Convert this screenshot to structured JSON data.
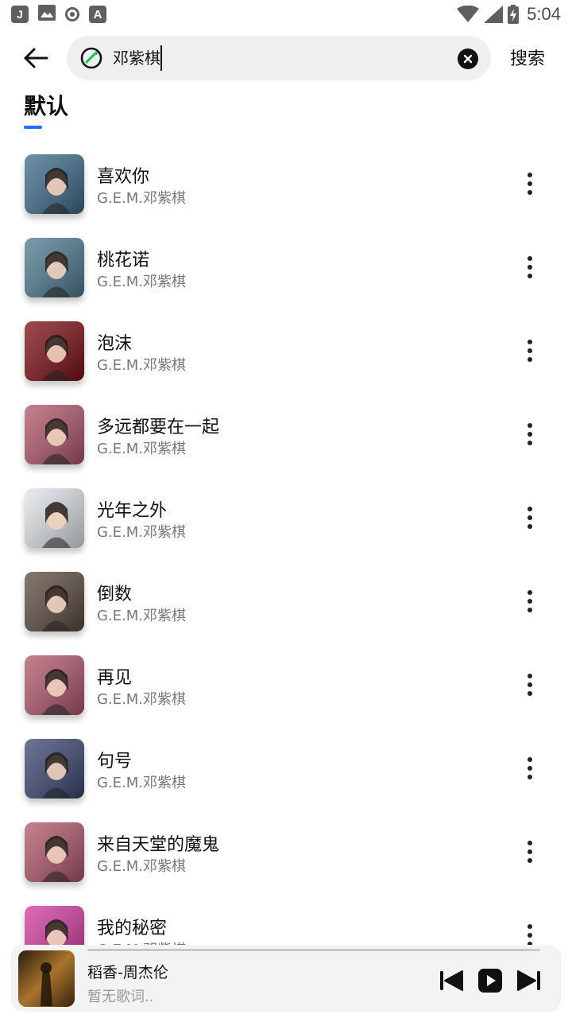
{
  "status_bar": {
    "left_icons": [
      "j-app-icon",
      "image-icon",
      "record-icon",
      "font-a-icon"
    ],
    "time": "5:04"
  },
  "search": {
    "query": "邓紫棋",
    "search_label": "搜索"
  },
  "tab": {
    "label": "默认"
  },
  "songs": [
    {
      "title": "喜欢你",
      "artist": "G.E.M.邓紫棋",
      "cover_color": "#3c6a8a"
    },
    {
      "title": "桃花诺",
      "artist": "G.E.M.邓紫棋",
      "cover_color": "#4d7a8f"
    },
    {
      "title": "泡沫",
      "artist": "G.E.M.邓紫棋",
      "cover_color": "#7a0d12"
    },
    {
      "title": "多远都要在一起",
      "artist": "G.E.M.邓紫棋",
      "cover_color": "#b0556a"
    },
    {
      "title": "光年之外",
      "artist": "G.E.M.邓紫棋",
      "cover_color": "#dfe5ea"
    },
    {
      "title": "倒数",
      "artist": "G.E.M.邓紫棋",
      "cover_color": "#5a4a3e"
    },
    {
      "title": "再见",
      "artist": "G.E.M.邓紫棋",
      "cover_color": "#b0556a"
    },
    {
      "title": "句号",
      "artist": "G.E.M.邓紫棋",
      "cover_color": "#3a4570"
    },
    {
      "title": "来自天堂的魔鬼",
      "artist": "G.E.M.邓紫棋",
      "cover_color": "#b0556a"
    },
    {
      "title": "我的秘密",
      "artist": "G.E.M.邓紫棋",
      "cover_color": "#d33aa0"
    }
  ],
  "player": {
    "title": "稻香-周杰伦",
    "lyric": "暂无歌词.."
  }
}
